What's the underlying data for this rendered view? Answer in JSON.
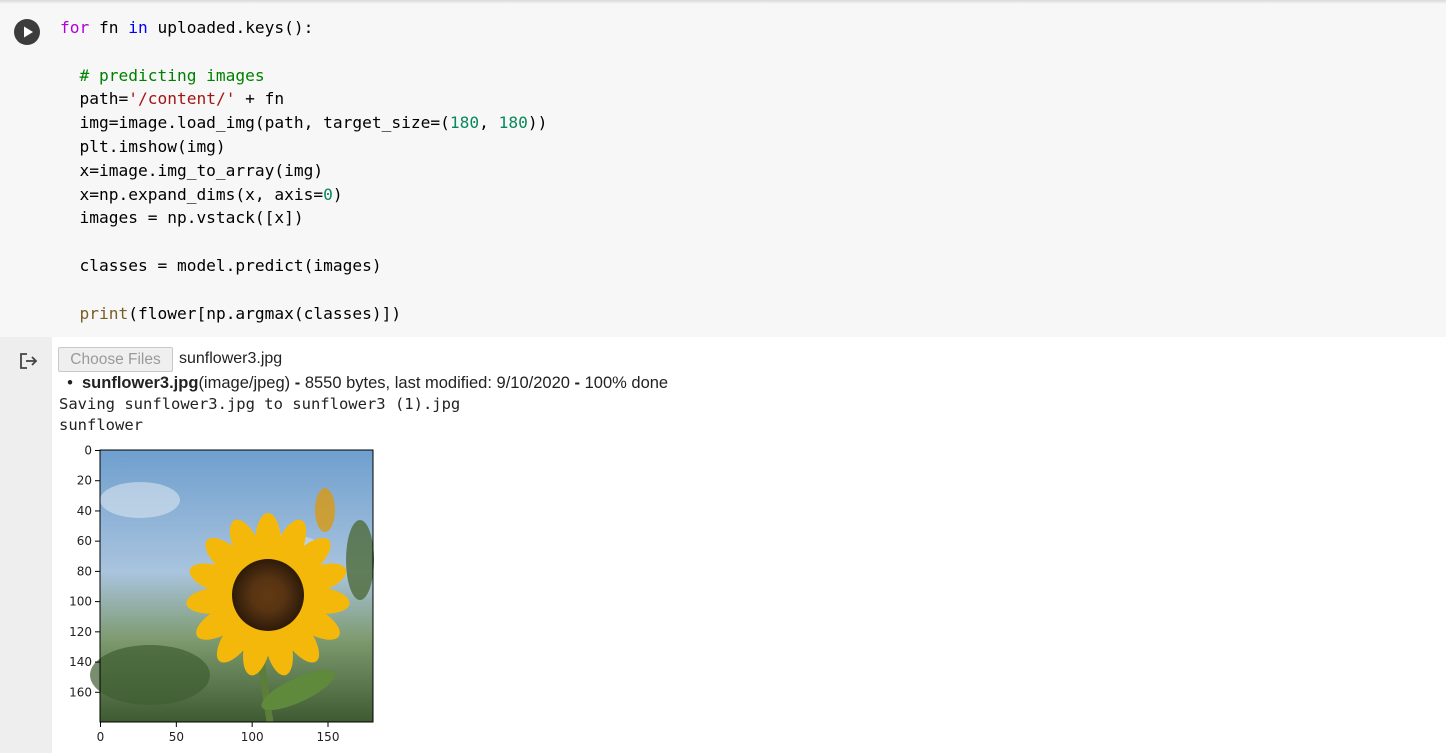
{
  "code_cell": {
    "lines": [
      [
        {
          "t": "for",
          "c": "kw"
        },
        {
          "t": " fn "
        },
        {
          "t": "in",
          "c": "kw2"
        },
        {
          "t": " uploaded.keys():"
        }
      ],
      [],
      [
        {
          "t": "  # predicting images",
          "c": "cm"
        }
      ],
      [
        {
          "t": "  path="
        },
        {
          "t": "'/content/'",
          "c": "st"
        },
        {
          "t": " + fn"
        }
      ],
      [
        {
          "t": "  img=image.load_img(path, target_size=("
        },
        {
          "t": "180",
          "c": "nu"
        },
        {
          "t": ", "
        },
        {
          "t": "180",
          "c": "nu"
        },
        {
          "t": "))"
        }
      ],
      [
        {
          "t": "  plt.imshow(img)"
        }
      ],
      [
        {
          "t": "  x=image.img_to_array(img)"
        }
      ],
      [
        {
          "t": "  x=np.expand_dims(x, axis="
        },
        {
          "t": "0",
          "c": "nu"
        },
        {
          "t": ")"
        }
      ],
      [
        {
          "t": "  images = np.vstack([x])"
        }
      ],
      [],
      [
        {
          "t": "  classes = model.predict(images)"
        }
      ],
      [],
      [
        {
          "t": "  "
        },
        {
          "t": "print",
          "c": "bi"
        },
        {
          "t": "(flower[np.argmax(classes)])"
        }
      ]
    ]
  },
  "output": {
    "choose_files_label": "Choose Files",
    "selected_file": "sunflower3.jpg",
    "file_info": {
      "bullet": "•",
      "name": "sunflower3.jpg",
      "type": "(image/jpeg)",
      "sep1": " - ",
      "details": "8550 bytes, last modified: 9/10/2020",
      "sep2": " - ",
      "progress": "100% done"
    },
    "saving_line": "Saving sunflower3.jpg to sunflower3 (1).jpg",
    "prediction": "sunflower"
  },
  "plot": {
    "y_ticks": [
      "0",
      "20",
      "40",
      "60",
      "80",
      "100",
      "120",
      "140",
      "160"
    ],
    "x_ticks": [
      "0",
      "50",
      "100",
      "150"
    ],
    "colors": {
      "sky": "#8fb6d8",
      "petal": "#f2b705",
      "center": "#4a2a10",
      "leaf": "#4f6b3a"
    }
  }
}
